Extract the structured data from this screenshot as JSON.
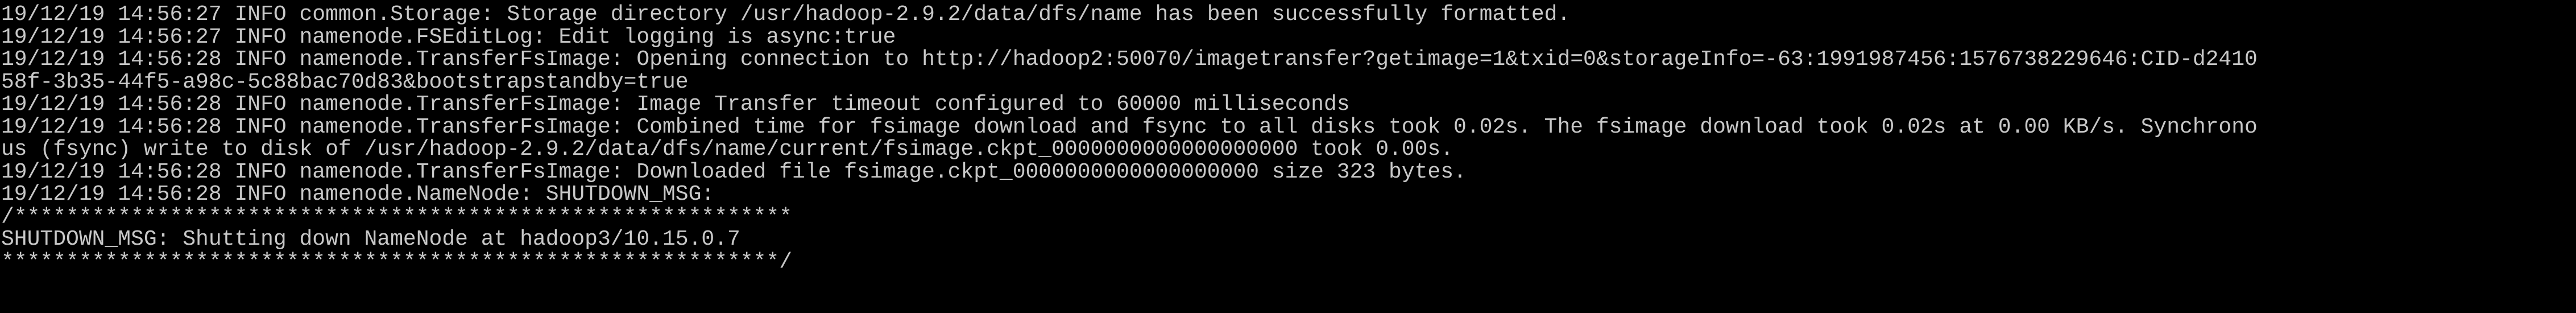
{
  "terminal": {
    "background": "#000000",
    "foreground": "#c8c8c8",
    "lines": [
      "19/12/19 14:56:27 INFO common.Storage: Storage directory /usr/hadoop-2.9.2/data/dfs/name has been successfully formatted.",
      "19/12/19 14:56:27 INFO namenode.FSEditLog: Edit logging is async:true",
      "19/12/19 14:56:28 INFO namenode.TransferFsImage: Opening connection to http://hadoop2:50070/imagetransfer?getimage=1&txid=0&storageInfo=-63:1991987456:1576738229646:CID-d2410",
      "58f-3b35-44f5-a98c-5c88bac70d83&bootstrapstandby=true",
      "19/12/19 14:56:28 INFO namenode.TransferFsImage: Image Transfer timeout configured to 60000 milliseconds",
      "19/12/19 14:56:28 INFO namenode.TransferFsImage: Combined time for fsimage download and fsync to all disks took 0.02s. The fsimage download took 0.02s at 0.00 KB/s. Synchrono",
      "us (fsync) write to disk of /usr/hadoop-2.9.2/data/dfs/name/current/fsimage.ckpt_0000000000000000000 took 0.00s.",
      "19/12/19 14:56:28 INFO namenode.TransferFsImage: Downloaded file fsimage.ckpt_0000000000000000000 size 323 bytes.",
      "19/12/19 14:56:28 INFO namenode.NameNode: SHUTDOWN_MSG:",
      "/************************************************************",
      "SHUTDOWN_MSG: Shutting down NameNode at hadoop3/10.15.0.7",
      "************************************************************/"
    ]
  }
}
